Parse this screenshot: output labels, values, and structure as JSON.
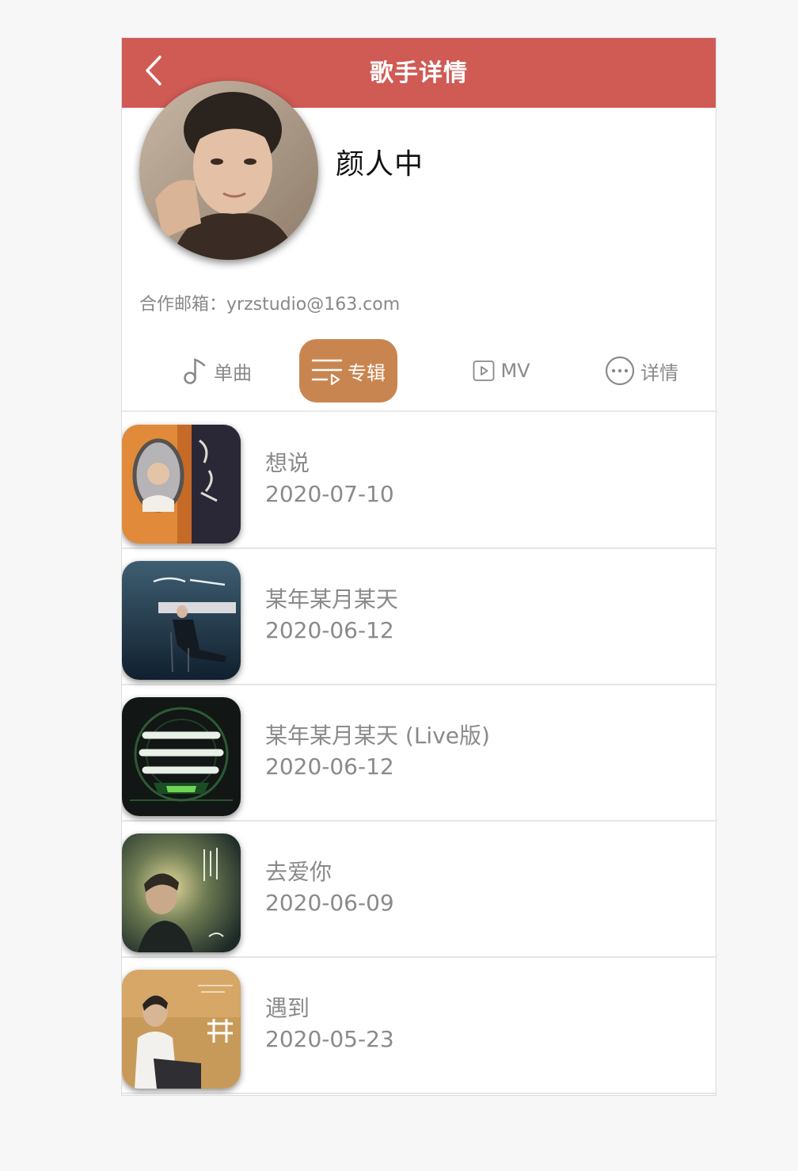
{
  "header": {
    "title": "歌手详情",
    "back_icon": "chevron-left-icon",
    "background": "#d05a54"
  },
  "singer": {
    "name": "颜人中",
    "contact_label": "合作邮箱：",
    "contact_email": "yrzstudio@163.com"
  },
  "tabs": [
    {
      "label": "单曲",
      "icon": "music-note-icon",
      "active": false
    },
    {
      "label": "专辑",
      "icon": "album-list-icon",
      "active": true
    },
    {
      "label": "MV",
      "icon": "video-play-icon",
      "active": false
    },
    {
      "label": "详情",
      "icon": "more-dots-icon",
      "active": false
    }
  ],
  "accent_color": "#c98550",
  "albums": [
    {
      "name": "想说",
      "date": "2020-07-10"
    },
    {
      "name": "某年某月某天",
      "date": "2020-06-12"
    },
    {
      "name": "某年某月某天 (Live版)",
      "date": "2020-06-12"
    },
    {
      "name": "去爱你",
      "date": "2020-06-09"
    },
    {
      "name": "遇到",
      "date": "2020-05-23"
    }
  ]
}
